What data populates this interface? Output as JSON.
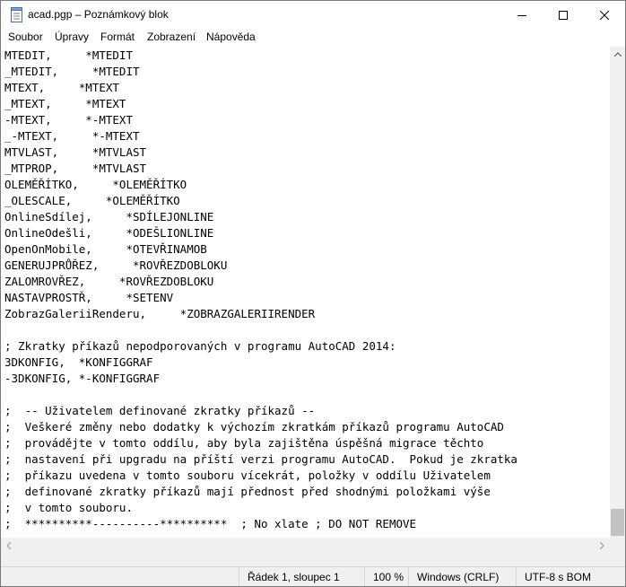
{
  "window": {
    "title": "acad.pgp – Poznámkový blok"
  },
  "menu": {
    "items": [
      "Soubor",
      "Úpravy",
      "Formát",
      "Zobrazení",
      "Nápověda"
    ]
  },
  "editor": {
    "lines": [
      "MTEDIT,     *MTEDIT",
      "_MTEDIT,     *MTEDIT",
      "MTEXT,     *MTEXT",
      "_MTEXT,     *MTEXT",
      "-MTEXT,     *-MTEXT",
      "_-MTEXT,     *-MTEXT",
      "MTVLAST,     *MTVLAST",
      "_MTPROP,     *MTVLAST",
      "OLEMĚŘÍTKO,     *OLEMĚŘÍTKO",
      "_OLESCALE,     *OLEMĚŘÍTKO",
      "OnlineSdílej,     *SDÍLEJONLINE",
      "OnlineOdešli,     *ODEŠLIONLINE",
      "OpenOnMobile,     *OTEVŘINAMOB",
      "GENERUJPRŮŘEZ,     *ROVŘEZDOBLOKU",
      "ZALOMROVŘEZ,     *ROVŘEZDOBLOKU",
      "NASTAVPROSTŘ,     *SETENV",
      "ZobrazGaleriiRenderu,     *ZOBRAZGALERIIRENDER",
      "",
      "; Zkratky příkazů nepodporovaných v programu AutoCAD 2014:",
      "3DKONFIG,  *KONFIGGRAF",
      "-3DKONFIG, *-KONFIGGRAF",
      "",
      ";  -- Uživatelem definované zkratky příkazů --",
      ";  Veškeré změny nebo dodatky k výchozím zkratkám příkazů programu AutoCAD",
      ";  provádějte v tomto oddílu, aby byla zajištěna úspěšná migrace těchto",
      ";  nastavení při upgradu na příští verzi programu AutoCAD.  Pokud je zkratka",
      ";  příkazu uvedena v tomto souboru vícekrát, položky v oddílu Uživatelem",
      ";  definované zkratky příkazů mají přednost před shodnými položkami výše",
      ";  v tomto souboru.",
      ";  **********----------**********  ; No xlate ; DO NOT REMOVE"
    ]
  },
  "status": {
    "position": "Řádek 1, sloupec 1",
    "zoom": "100 %",
    "line_ending": "Windows (CRLF)",
    "encoding": "UTF-8 s BOM"
  },
  "icons": {
    "app": "notepad-icon",
    "minimize": "minimize-icon",
    "maximize": "maximize-icon",
    "close": "close-icon"
  }
}
